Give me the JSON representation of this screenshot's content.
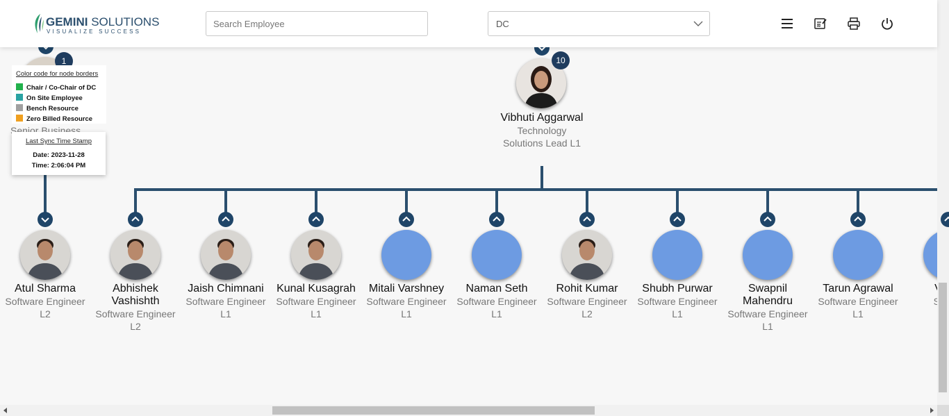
{
  "header": {
    "brand_bold": "GEMINI",
    "brand_rest": "SOLUTIONS",
    "tagline": "VISUALIZE SUCCESS",
    "search_placeholder": "Search Employee",
    "dc_selected": "DC",
    "icons": [
      "menu-icon",
      "sign-icon",
      "print-icon",
      "power-icon"
    ]
  },
  "legend": {
    "title": "Color code for node borders",
    "items": [
      {
        "label": "Chair / Co-Chair of DC",
        "color": "#22b14c"
      },
      {
        "label": "On Site Employee",
        "color": "#2aa3a3"
      },
      {
        "label": "Bench Resource",
        "color": "#a0a0a0"
      },
      {
        "label": "Zero Billed Resource",
        "color": "#f0a020"
      }
    ]
  },
  "sync": {
    "title": "Last Sync Time Stamp",
    "date": "Date: 2023-11-28",
    "time": "Time: 2:06:04 PM"
  },
  "partial_left": {
    "badge": "1",
    "role_fragment": "Senior Business"
  },
  "manager": {
    "name": "Vibhuti Aggarwal",
    "role_line1": "Technology",
    "role_line2": "Solutions Lead L1",
    "badge": "10"
  },
  "reports": [
    {
      "name": "Atul Sharma",
      "role": "Software Engineer",
      "level": "L2",
      "photo": true
    },
    {
      "name": "Abhishek Vashishth",
      "role": "Software Engineer",
      "level": "L2",
      "photo": true
    },
    {
      "name": "Jaish Chimnani",
      "role": "Software Engineer",
      "level": "L1",
      "photo": true
    },
    {
      "name": "Kunal Kusagrah",
      "role": "Software Engineer",
      "level": "L1",
      "photo": true
    },
    {
      "name": "Mitali Varshney",
      "role": "Software Engineer",
      "level": "L1",
      "photo": false
    },
    {
      "name": "Naman Seth",
      "role": "Software Engineer",
      "level": "L1",
      "photo": false
    },
    {
      "name": "Rohit Kumar",
      "role": "Software Engineer",
      "level": "L2",
      "photo": true
    },
    {
      "name": "Shubh Purwar",
      "role": "Software Engineer",
      "level": "L1",
      "photo": false
    },
    {
      "name": "Swapnil Mahendru",
      "role": "Software Engineer",
      "level": "L1",
      "photo": false
    },
    {
      "name": "Tarun Agrawal",
      "role": "Software Engineer",
      "level": "L1",
      "photo": false
    },
    {
      "name": "Visha",
      "role": "Softwa",
      "level": "",
      "photo": false
    }
  ],
  "colors": {
    "primary": "#1f4568",
    "node_blue": "#6d9be2"
  }
}
